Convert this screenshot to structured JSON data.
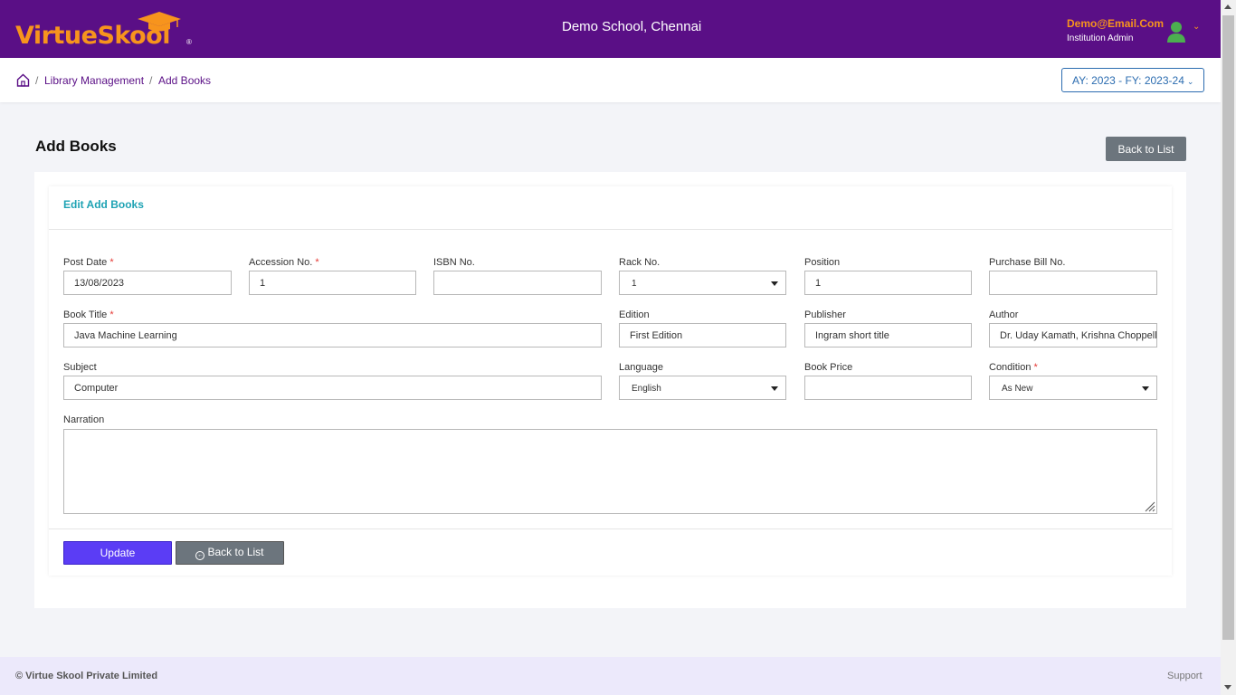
{
  "header": {
    "logo_text_a": "Virtue",
    "logo_text_b": "Skool",
    "logo_reg": "®",
    "school_name": "Demo School, Chennai",
    "user_email": "Demo@Email.Com",
    "user_role": "Institution Admin",
    "user_caret": "⌄"
  },
  "breadcrumb": {
    "items": [
      "Library Management",
      "Add Books"
    ],
    "separator": "/",
    "academic_year": "AY: 2023 - FY: 2023-24",
    "academic_year_caret": "⌄"
  },
  "page": {
    "title": "Add Books",
    "back_to_list_top": "Back to List"
  },
  "form": {
    "card_title": "Edit Add Books",
    "required_mark": "*",
    "post_date": {
      "label": "Post Date",
      "value": "13/08/2023"
    },
    "accession_no": {
      "label": "Accession No.",
      "value": "1"
    },
    "isbn_no": {
      "label": "ISBN No.",
      "value": ""
    },
    "rack_no": {
      "label": "Rack No.",
      "value": "1"
    },
    "position": {
      "label": "Position",
      "value": "1"
    },
    "purchase_bill_no": {
      "label": "Purchase Bill No.",
      "value": ""
    },
    "book_title": {
      "label": "Book Title",
      "value": "Java Machine Learning"
    },
    "edition": {
      "label": "Edition",
      "value": "First Edition"
    },
    "publisher": {
      "label": "Publisher",
      "value": "Ingram short title"
    },
    "author": {
      "label": "Author",
      "value": "Dr. Uday Kamath, Krishna Choppella"
    },
    "subject": {
      "label": "Subject",
      "value": "Computer"
    },
    "language": {
      "label": "Language",
      "value": "English"
    },
    "book_price": {
      "label": "Book Price",
      "value": ""
    },
    "condition": {
      "label": "Condition",
      "value": "As New"
    },
    "narration": {
      "label": "Narration",
      "value": ""
    },
    "update_button": "Update",
    "back_to_list_button": "Back to List"
  },
  "footer": {
    "copyright": "© Virtue Skool Private Limited",
    "support": "Support"
  },
  "colors": {
    "header_bg": "#5a0f86",
    "accent_orange": "#f7941d",
    "update_button": "#5b3df5",
    "secondary_button": "#6c757d",
    "card_title": "#1fa3b4",
    "footer_bg": "#ece9fb"
  }
}
